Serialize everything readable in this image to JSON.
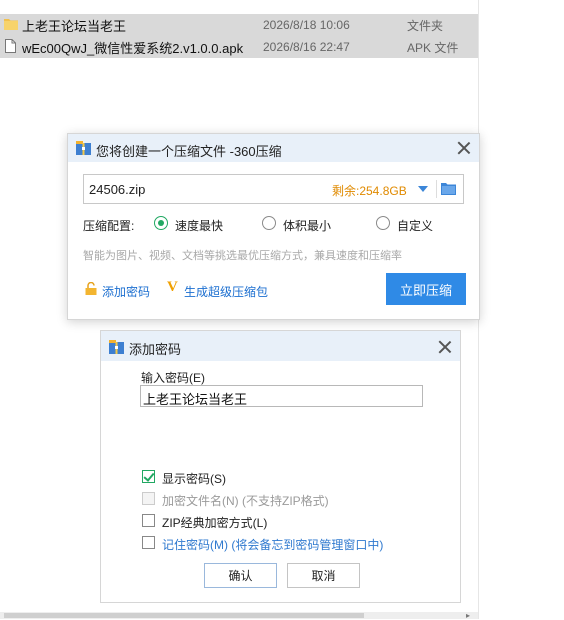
{
  "file_list": {
    "rows": [
      {
        "name": "上老王论坛当老王",
        "date": "2026/8/18 10:06",
        "type": "文件夹",
        "icon": "folder-icon"
      },
      {
        "name": "wEc00QwJ_微信性爱系统2.v1.0.0.apk",
        "date": "2026/8/16 22:47",
        "type": "APK 文件",
        "icon": "file-icon"
      }
    ]
  },
  "compress_dialog": {
    "title": "您将创建一个压缩文件 -360压缩",
    "filename": "24506.zip",
    "free_space": "剩余:254.8GB",
    "config_label": "压缩配置:",
    "options": [
      {
        "label": "速度最快",
        "checked": true
      },
      {
        "label": "体积最小",
        "checked": false
      },
      {
        "label": "自定义",
        "checked": false
      }
    ],
    "hint": "智能为图片、视频、文档等挑选最优压缩方式，兼具速度和压缩率",
    "add_password_link": "添加密码",
    "super_pack_link": "生成超级压缩包",
    "super_pack_badge": "V",
    "compress_button": "立即压缩"
  },
  "password_dialog": {
    "title": "添加密码",
    "input_label": "输入密码(E)",
    "password_value": "上老王论坛当老王",
    "options": [
      {
        "label": "显示密码(S)",
        "note": "",
        "checked": true,
        "disabled": false
      },
      {
        "label": "加密文件名(N)",
        "note": " (不支持ZIP格式)",
        "checked": false,
        "disabled": true
      },
      {
        "label": "ZIP经典加密方式(L)",
        "note": "",
        "checked": false,
        "disabled": false
      },
      {
        "label": "记住密码(M)",
        "note": " (将会备忘到密码管理窗口中)",
        "checked": false,
        "disabled": false
      }
    ],
    "ok_button": "确认",
    "cancel_button": "取消"
  },
  "colors": {
    "accent_blue": "#2f8ae6",
    "radio_green": "#21a862",
    "free_space_orange": "#e08a00",
    "title_bar": "#e8f0f9"
  }
}
